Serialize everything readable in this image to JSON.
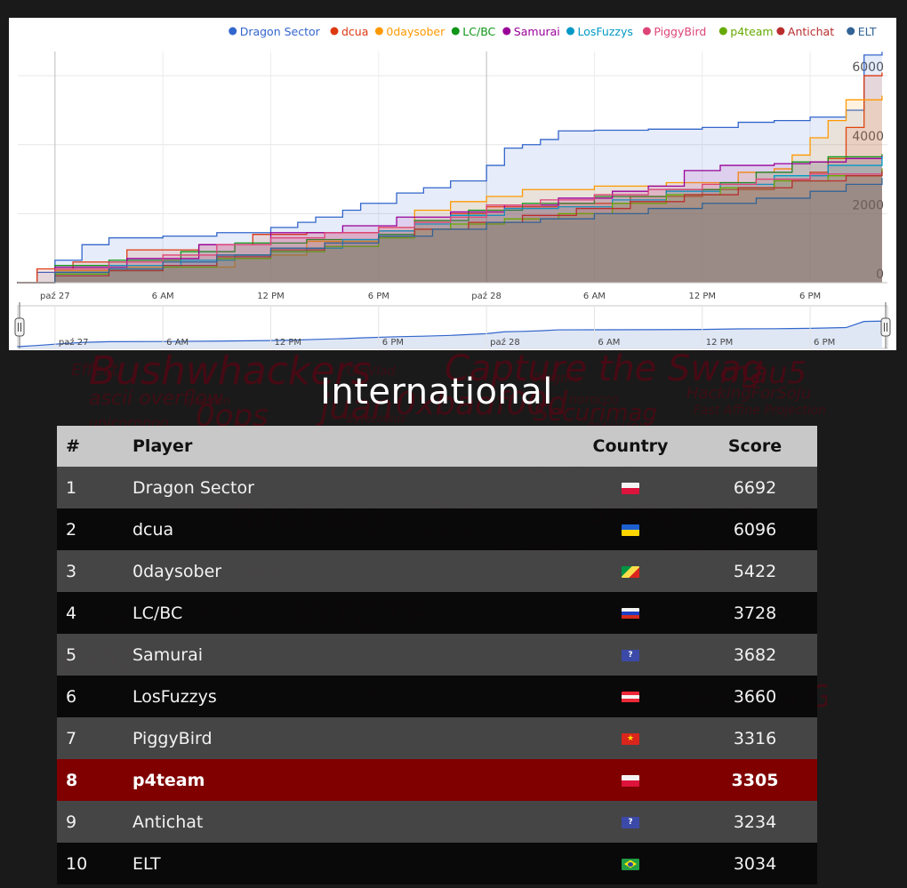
{
  "title": "International",
  "background_words": [
    "Bushwhackers",
    "Capture the Swag",
    "mau5",
    "HackingForSoju",
    "ascii overflow",
    "0ops",
    "juan",
    "0xbadf00d",
    "Securimag",
    "p4",
    "Rdot.org",
    "KITCTF",
    "Shellphish",
    "0x51a",
    "CLGT",
    "SKUI",
    "Kesatria Garuda",
    "TKUS",
    "BelloWeb",
    "GinVlad",
    "Pingme",
    "Fast Affine Projection",
    "goemon",
    "unicornpoo",
    "norocco",
    "gr00t",
    "Bl4ckH0l3",
    "Bytecodius",
    "Fhunter",
    "ufologists",
    "Effect",
    "b1o",
    "d24",
    "cmp",
    "Tasteless",
    "Rogue",
    "S0l0BOY",
    "squareroots",
    "REU",
    "FAUST",
    "haXxor"
  ],
  "chart_data": {
    "type": "line",
    "legend_position": "top-right",
    "x_tick_labels": [
      "paź 27",
      "6 AM",
      "12 PM",
      "6 PM",
      "paź 28",
      "6 AM",
      "12 PM",
      "6 PM"
    ],
    "x_ticks_hours": [
      0,
      6,
      12,
      18,
      24,
      30,
      36,
      42
    ],
    "x_range_hours": [
      -2.07,
      46.3
    ],
    "ylim": [
      0,
      6700
    ],
    "y_ticks": [
      "0",
      "2000",
      "4000",
      "6000"
    ],
    "y_tick_values": [
      0,
      2000,
      4000,
      6000
    ],
    "navigator_tick_labels": [
      "paź 27",
      "6 AM",
      "12 PM",
      "6 PM",
      "paź 28",
      "6 AM",
      "12 PM",
      "6 PM"
    ],
    "series": [
      {
        "name": "Dragon Sector",
        "color": "#3366cc",
        "points": [
          [
            -2.1,
            0
          ],
          [
            -1,
            300
          ],
          [
            0,
            650
          ],
          [
            1.5,
            1100
          ],
          [
            3,
            1300
          ],
          [
            6,
            1350
          ],
          [
            9,
            1450
          ],
          [
            12,
            1600
          ],
          [
            13.5,
            1750
          ],
          [
            14.5,
            1900
          ],
          [
            16,
            2100
          ],
          [
            17,
            2300
          ],
          [
            19,
            2600
          ],
          [
            20.5,
            2750
          ],
          [
            22,
            2950
          ],
          [
            24,
            3400
          ],
          [
            25,
            3900
          ],
          [
            26,
            4000
          ],
          [
            27,
            4150
          ],
          [
            28,
            4400
          ],
          [
            30,
            4420
          ],
          [
            33,
            4450
          ],
          [
            36,
            4500
          ],
          [
            38,
            4650
          ],
          [
            40,
            4700
          ],
          [
            42,
            4800
          ],
          [
            44,
            5000
          ],
          [
            45,
            6600
          ],
          [
            46,
            6692
          ]
        ]
      },
      {
        "name": "dcua",
        "color": "#dc3912",
        "points": [
          [
            -2.1,
            0
          ],
          [
            -1,
            400
          ],
          [
            1,
            600
          ],
          [
            4,
            950
          ],
          [
            8,
            1100
          ],
          [
            11,
            1400
          ],
          [
            14,
            1450
          ],
          [
            18,
            1500
          ],
          [
            20,
            1800
          ],
          [
            22,
            2000
          ],
          [
            24,
            2200
          ],
          [
            28,
            2300
          ],
          [
            32,
            2500
          ],
          [
            36,
            2700
          ],
          [
            40,
            3000
          ],
          [
            42,
            3200
          ],
          [
            43,
            3600
          ],
          [
            44,
            4500
          ],
          [
            45,
            6000
          ],
          [
            46,
            6096
          ]
        ]
      },
      {
        "name": "0daysober",
        "color": "#ff9900",
        "points": [
          [
            -2.1,
            0
          ],
          [
            0,
            350
          ],
          [
            4,
            450
          ],
          [
            10,
            800
          ],
          [
            14,
            1200
          ],
          [
            18,
            1600
          ],
          [
            20,
            2100
          ],
          [
            22,
            2350
          ],
          [
            24,
            2500
          ],
          [
            26,
            2700
          ],
          [
            30,
            2800
          ],
          [
            34,
            2900
          ],
          [
            38,
            3200
          ],
          [
            40,
            3300
          ],
          [
            41,
            3700
          ],
          [
            42,
            4200
          ],
          [
            43,
            4700
          ],
          [
            44,
            5300
          ],
          [
            46,
            5422
          ]
        ]
      },
      {
        "name": "LC/BC",
        "color": "#109618",
        "points": [
          [
            -2.1,
            0
          ],
          [
            0,
            500
          ],
          [
            3,
            650
          ],
          [
            7,
            900
          ],
          [
            10,
            1150
          ],
          [
            14,
            1250
          ],
          [
            18,
            1400
          ],
          [
            20,
            1800
          ],
          [
            23,
            2100
          ],
          [
            26,
            2300
          ],
          [
            30,
            2500
          ],
          [
            34,
            2700
          ],
          [
            37,
            2900
          ],
          [
            39,
            3200
          ],
          [
            41,
            3500
          ],
          [
            43,
            3650
          ],
          [
            46,
            3728
          ]
        ]
      },
      {
        "name": "Samurai",
        "color": "#990099",
        "points": [
          [
            -2.1,
            0
          ],
          [
            0,
            450
          ],
          [
            4,
            700
          ],
          [
            8,
            1100
          ],
          [
            12,
            1450
          ],
          [
            16,
            1650
          ],
          [
            19,
            1900
          ],
          [
            22,
            2050
          ],
          [
            25,
            2250
          ],
          [
            28,
            2450
          ],
          [
            31,
            2650
          ],
          [
            33,
            2800
          ],
          [
            35,
            3250
          ],
          [
            37,
            3400
          ],
          [
            40,
            3450
          ],
          [
            42,
            3500
          ],
          [
            44,
            3600
          ],
          [
            46,
            3682
          ]
        ]
      },
      {
        "name": "LosFuzzys",
        "color": "#0099c6",
        "points": [
          [
            -2.1,
            0
          ],
          [
            0,
            300
          ],
          [
            3,
            500
          ],
          [
            7,
            650
          ],
          [
            10,
            800
          ],
          [
            12,
            900
          ],
          [
            14,
            1000
          ],
          [
            16,
            1250
          ],
          [
            18,
            1500
          ],
          [
            20,
            1700
          ],
          [
            22,
            1950
          ],
          [
            25,
            2150
          ],
          [
            28,
            2200
          ],
          [
            31,
            2400
          ],
          [
            34,
            2650
          ],
          [
            37,
            2850
          ],
          [
            40,
            3100
          ],
          [
            43,
            3400
          ],
          [
            46,
            3660
          ]
        ]
      },
      {
        "name": "PiggyBird",
        "color": "#dd4477",
        "points": [
          [
            -2.1,
            0
          ],
          [
            0,
            400
          ],
          [
            3,
            600
          ],
          [
            6,
            800
          ],
          [
            9,
            1100
          ],
          [
            12,
            1300
          ],
          [
            15,
            1450
          ],
          [
            18,
            1600
          ],
          [
            20,
            1750
          ],
          [
            22,
            1900
          ],
          [
            24,
            2250
          ],
          [
            27,
            2400
          ],
          [
            30,
            2550
          ],
          [
            33,
            2700
          ],
          [
            36,
            2850
          ],
          [
            39,
            3000
          ],
          [
            42,
            3150
          ],
          [
            46,
            3316
          ]
        ]
      },
      {
        "name": "p4team",
        "color": "#66aa00",
        "points": [
          [
            -2.1,
            0
          ],
          [
            0,
            250
          ],
          [
            3,
            350
          ],
          [
            6,
            450
          ],
          [
            9,
            700
          ],
          [
            12,
            900
          ],
          [
            15,
            1050
          ],
          [
            18,
            1300
          ],
          [
            20,
            1550
          ],
          [
            22,
            1700
          ],
          [
            25,
            1850
          ],
          [
            28,
            2000
          ],
          [
            31,
            2300
          ],
          [
            34,
            2550
          ],
          [
            37,
            2750
          ],
          [
            40,
            2950
          ],
          [
            43,
            3100
          ],
          [
            46,
            3305
          ]
        ]
      },
      {
        "name": "Antichat",
        "color": "#b82e2e",
        "points": [
          [
            -2.1,
            0
          ],
          [
            0,
            200
          ],
          [
            3,
            350
          ],
          [
            6,
            500
          ],
          [
            9,
            750
          ],
          [
            12,
            950
          ],
          [
            15,
            1150
          ],
          [
            18,
            1350
          ],
          [
            20,
            1550
          ],
          [
            23,
            1750
          ],
          [
            26,
            1950
          ],
          [
            29,
            2150
          ],
          [
            32,
            2350
          ],
          [
            35,
            2550
          ],
          [
            38,
            2750
          ],
          [
            41,
            2950
          ],
          [
            44,
            3100
          ],
          [
            46,
            3234
          ]
        ]
      },
      {
        "name": "ELT",
        "color": "#316395",
        "points": [
          [
            -2.1,
            0
          ],
          [
            0,
            300
          ],
          [
            3,
            400
          ],
          [
            6,
            600
          ],
          [
            9,
            800
          ],
          [
            12,
            1000
          ],
          [
            15,
            1150
          ],
          [
            18,
            1350
          ],
          [
            21,
            1550
          ],
          [
            24,
            1750
          ],
          [
            27,
            1850
          ],
          [
            30,
            2000
          ],
          [
            33,
            2150
          ],
          [
            36,
            2300
          ],
          [
            39,
            2450
          ],
          [
            42,
            2650
          ],
          [
            44,
            2850
          ],
          [
            46,
            3034
          ]
        ]
      }
    ]
  },
  "table": {
    "headers": {
      "rank": "#",
      "player": "Player",
      "country": "Country",
      "score": "Score"
    },
    "rows": [
      {
        "rank": "1",
        "player": "Dragon Sector",
        "flag": "pl",
        "score": "6692",
        "highlight": false
      },
      {
        "rank": "2",
        "player": "dcua",
        "flag": "ua",
        "score": "6096",
        "highlight": false
      },
      {
        "rank": "3",
        "player": "0daysober",
        "flag": "cg",
        "score": "5422",
        "highlight": false
      },
      {
        "rank": "4",
        "player": "LC/BC",
        "flag": "ru",
        "score": "3728",
        "highlight": false
      },
      {
        "rank": "5",
        "player": "Samurai",
        "flag": "unknown",
        "score": "3682",
        "highlight": false
      },
      {
        "rank": "6",
        "player": "LosFuzzys",
        "flag": "at",
        "score": "3660",
        "highlight": false
      },
      {
        "rank": "7",
        "player": "PiggyBird",
        "flag": "vn",
        "score": "3316",
        "highlight": false
      },
      {
        "rank": "8",
        "player": "p4team",
        "flag": "pl",
        "score": "3305",
        "highlight": true
      },
      {
        "rank": "9",
        "player": "Antichat",
        "flag": "unknown",
        "score": "3234",
        "highlight": false
      },
      {
        "rank": "10",
        "player": "ELT",
        "flag": "br",
        "score": "3034",
        "highlight": false
      }
    ]
  }
}
